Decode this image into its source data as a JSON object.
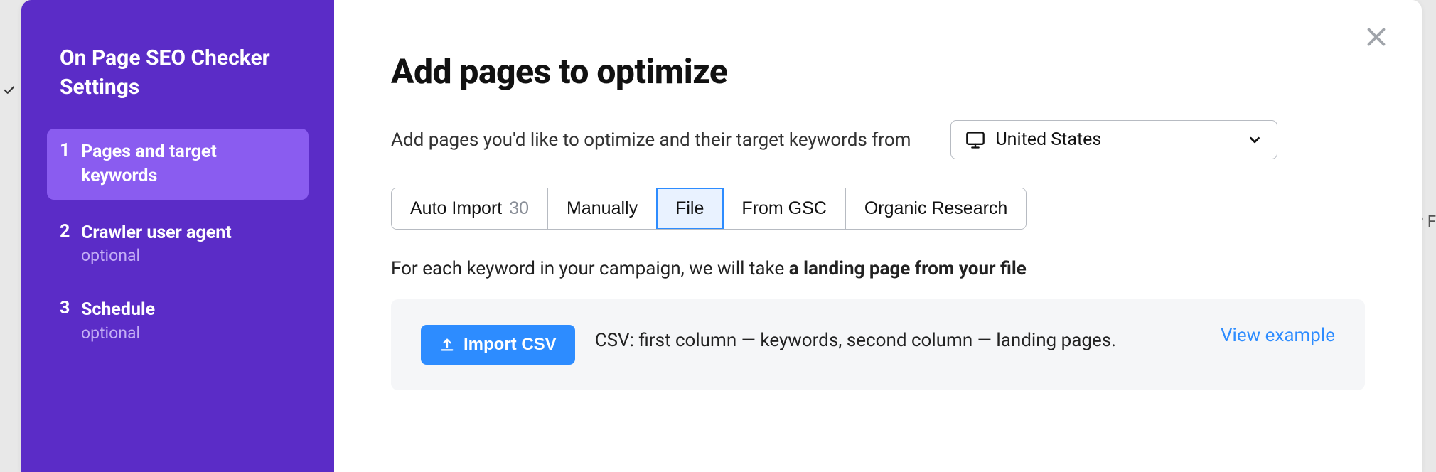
{
  "sidebar": {
    "title": "On Page SEO Checker Settings",
    "steps": [
      {
        "num": "1",
        "label": "Pages and target keywords",
        "optional": ""
      },
      {
        "num": "2",
        "label": "Crawler user agent",
        "optional": "optional"
      },
      {
        "num": "3",
        "label": "Schedule",
        "optional": "optional"
      }
    ]
  },
  "main": {
    "title": "Add pages to optimize",
    "intro": "Add pages you'd like to optimize and their target keywords from",
    "country": "United States",
    "tabs": {
      "auto_import": "Auto Import",
      "auto_import_count": "30",
      "manually": "Manually",
      "file": "File",
      "from_gsc": "From GSC",
      "organic": "Organic Research"
    },
    "description_pre": "For each keyword in your campaign, we will take ",
    "description_bold": "a landing page from your file",
    "import_btn": "Import CSV",
    "import_desc": "CSV: first column — keywords, second column — landing pages.",
    "view_example": "View example"
  },
  "bg": {
    "rp": "RP F"
  }
}
